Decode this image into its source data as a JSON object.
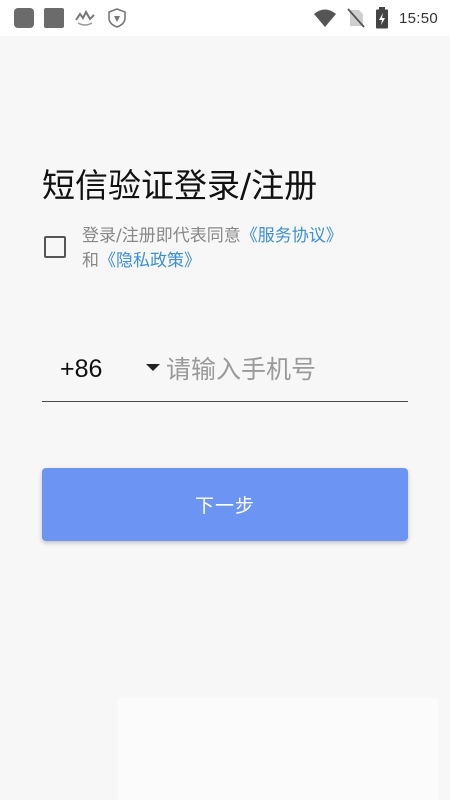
{
  "status_bar": {
    "time": "15:50",
    "left_icons": [
      "app-icon",
      "app-icon",
      "notification-icon",
      "shield-icon"
    ],
    "right_icons": [
      "wifi-icon",
      "no-sim-icon",
      "battery-charging-icon"
    ]
  },
  "title": "短信验证登录/注册",
  "agreement": {
    "checked": false,
    "prefix": "登录/注册即代表同意",
    "service_link": "《服务协议》",
    "conjunction": "和",
    "privacy_link": "《隐私政策》"
  },
  "phone": {
    "country_code": "+86",
    "placeholder": "请输入手机号",
    "value": ""
  },
  "next_button": {
    "label": "下一步"
  },
  "colors": {
    "accent": "#6b94f3",
    "link": "#3d8fd6",
    "background": "#f7f7f7"
  }
}
